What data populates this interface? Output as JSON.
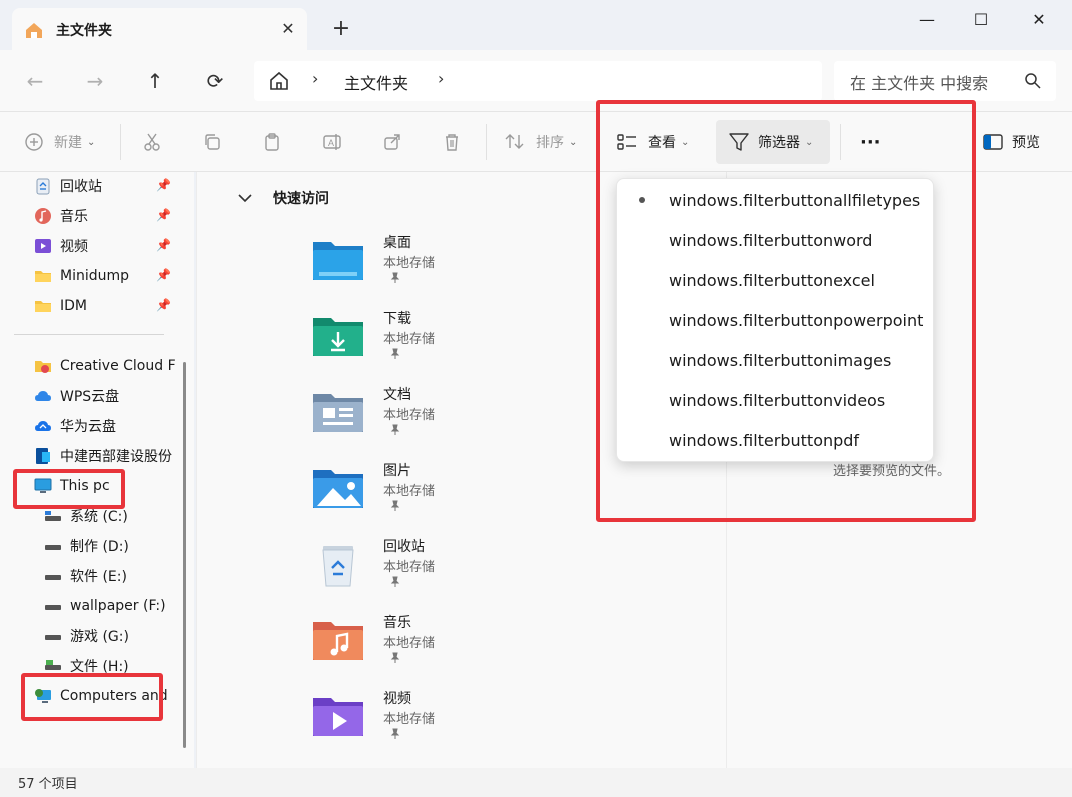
{
  "window": {
    "tab_title": "主文件夹",
    "tab_close": "✕",
    "new_tab": "+",
    "minimize": "—",
    "maximize": "☐",
    "close": "✕"
  },
  "address": {
    "back": "←",
    "forward": "→",
    "up": "↑",
    "refresh": "⟳",
    "crumb": "主文件夹",
    "search_placeholder": "在 主文件夹 中搜索"
  },
  "toolbar": {
    "new_label": "新建",
    "sort_label": "排序",
    "view_label": "查看",
    "filter_label": "筛选器",
    "more_label": "···",
    "preview_label": "预览"
  },
  "sidebar": {
    "pinned": [
      {
        "label": "回收站",
        "icon": "recycle-bin-icon"
      },
      {
        "label": "音乐",
        "icon": "music-icon"
      },
      {
        "label": "视频",
        "icon": "video-icon"
      },
      {
        "label": "Minidump",
        "icon": "folder-icon"
      },
      {
        "label": "IDM",
        "icon": "folder-icon"
      }
    ],
    "locations": [
      {
        "label": "Creative Cloud F",
        "icon": "creative-cloud-icon"
      },
      {
        "label": "WPS云盘",
        "icon": "cloud-icon"
      },
      {
        "label": "华为云盘",
        "icon": "cloud-icon"
      },
      {
        "label": "中建西部建设股份",
        "icon": "sharepoint-icon"
      },
      {
        "label": "This pc",
        "icon": "monitor-icon"
      },
      {
        "label": "系统 (C:)",
        "icon": "drive-icon"
      },
      {
        "label": "制作 (D:)",
        "icon": "drive-icon"
      },
      {
        "label": "软件 (E:)",
        "icon": "drive-icon"
      },
      {
        "label": "wallpaper (F:)",
        "icon": "drive-icon"
      },
      {
        "label": "游戏 (G:)",
        "icon": "drive-icon"
      },
      {
        "label": "文件 (H:)",
        "icon": "drive-icon"
      },
      {
        "label": "Computers and",
        "icon": "network-icon"
      }
    ]
  },
  "main": {
    "group_title": "快速访问",
    "items": [
      {
        "name": "桌面",
        "sub": "本地存储",
        "icon": "desktop-folder-icon"
      },
      {
        "name": "下载",
        "sub": "本地存储",
        "icon": "downloads-folder-icon"
      },
      {
        "name": "文档",
        "sub": "本地存储",
        "icon": "documents-folder-icon"
      },
      {
        "name": "图片",
        "sub": "本地存储",
        "icon": "pictures-folder-icon"
      },
      {
        "name": "回收站",
        "sub": "本地存储",
        "icon": "recycle-bin-icon"
      },
      {
        "name": "音乐",
        "sub": "本地存储",
        "icon": "music-folder-icon"
      },
      {
        "name": "视频",
        "sub": "本地存储",
        "icon": "videos-folder-icon"
      }
    ]
  },
  "preview": {
    "hint": "选择要预览的文件。"
  },
  "filter_menu": {
    "items": [
      "windows.filterbuttonallfiletypes",
      "windows.filterbuttonword",
      "windows.filterbuttonexcel",
      "windows.filterbuttonpowerpoint",
      "windows.filterbuttonimages",
      "windows.filterbuttonvideos",
      "windows.filterbuttonpdf"
    ],
    "selected_index": 0
  },
  "status": {
    "count": "57 个项目"
  },
  "colors": {
    "highlight": "#e8353b",
    "accent": "#0067c0"
  }
}
